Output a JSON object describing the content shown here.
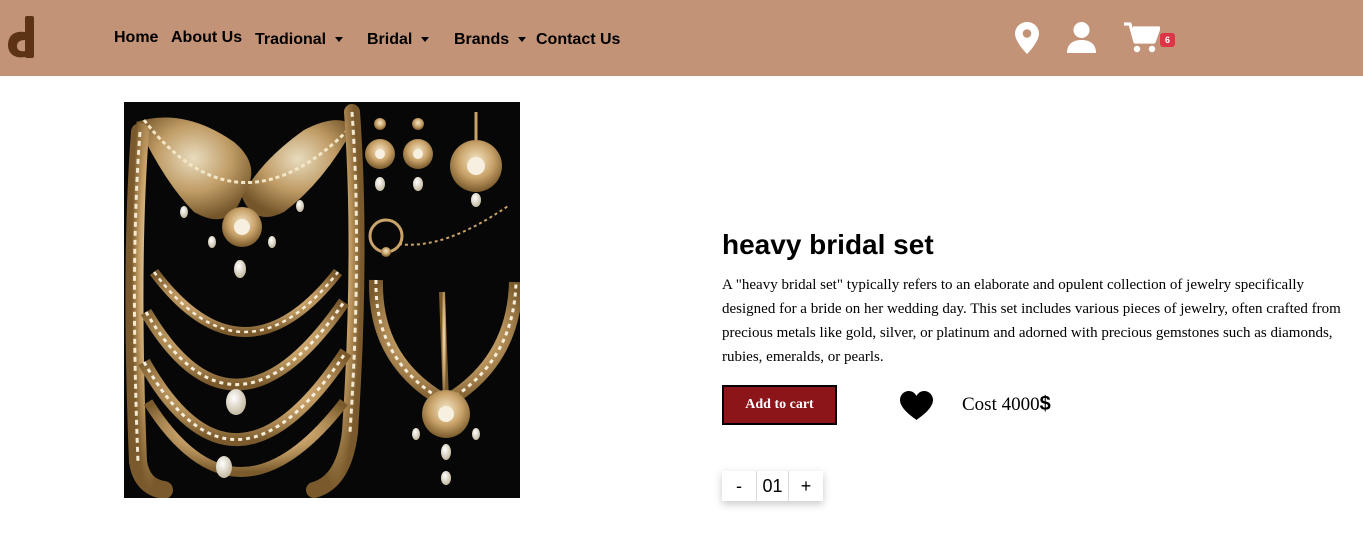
{
  "brand": {
    "logo_icon": "d-letter-logo-icon",
    "logo_color": "#5c3414"
  },
  "header": {
    "background": "#c39377"
  },
  "nav": {
    "home": "Home",
    "about": "About Us",
    "traditional": "Tradional",
    "bridal": "Bridal",
    "brands": "Brands",
    "contact": "Contact Us"
  },
  "icons": {
    "location": "location-pin-icon",
    "account": "user-icon",
    "cart": "shopping-cart-icon",
    "wishlist": "heart-icon"
  },
  "cart": {
    "count": "6",
    "badge_color": "#dc3545"
  },
  "product": {
    "image_alt": "bridal jewelry set photo",
    "title": "heavy bridal set",
    "description": "A \"heavy bridal set\" typically refers to an elaborate and opulent collection of jewelry specifically designed for a bride on her wedding day. This set includes various pieces of jewelry, often crafted from precious metals like gold, silver, or platinum and adorned with precious gemstones such as diamonds, rubies, emeralds, or pearls.",
    "add_to_cart": "Add to cart",
    "cost_label": "Cost 4000",
    "currency": "$",
    "button_color": "#8b1518"
  },
  "quantity": {
    "decrement": "-",
    "value": "01",
    "increment": "+"
  }
}
